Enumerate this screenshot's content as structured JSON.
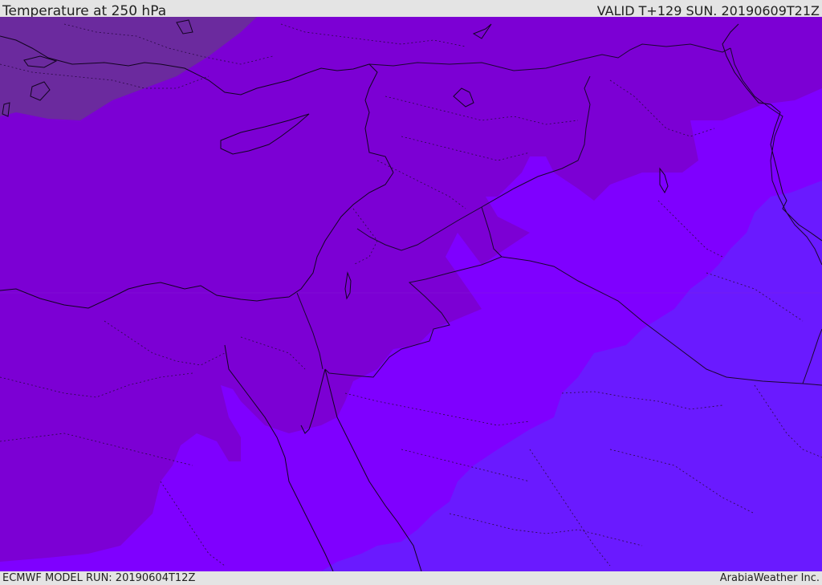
{
  "header": {
    "title": "Temperature at 250 hPa",
    "valid": "VALID T+129 SUN. 20190609T21Z"
  },
  "footer": {
    "model_run": "ECMWF MODEL RUN: 20190604T12Z",
    "credit": "ArabiaWeather Inc."
  },
  "map": {
    "colors": {
      "band_warmest": "#6b2a9e",
      "band_warm": "#7c00d4",
      "band_mid": "#7f00ff",
      "band_cool": "#6a1aff",
      "outline": "#120420",
      "frame": "#e4e4e4"
    }
  }
}
